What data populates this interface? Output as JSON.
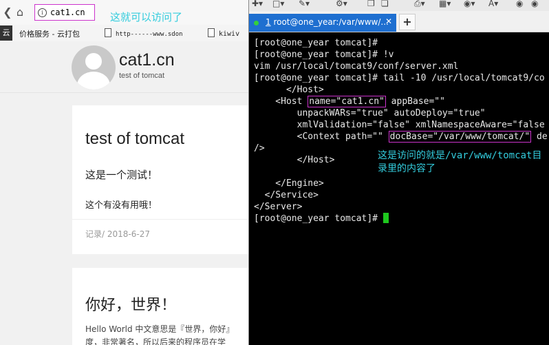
{
  "browser": {
    "url": "cat1.cn",
    "annotation": "这就可以访问了",
    "bookmarks": {
      "cloud": "云",
      "item1": "价格服务 - 云打包",
      "item2": "http------www.sdon",
      "item3": "kiwiv"
    },
    "site": {
      "title": "cat1.cn",
      "subtitle": "test of tomcat"
    },
    "post1": {
      "title": "test of tomcat",
      "line1": "这是一个测试！",
      "line2": "这个有没有用哦！",
      "meta": "记录/  2018-6-27"
    },
    "post2": {
      "title": "你好，世界！",
      "excerpt_line1": "Hello World 中文意思是『世界，你好』",
      "excerpt_line2": "度，非常著名，所以后来的程序员在学"
    }
  },
  "terminal": {
    "tab_number": "1",
    "tab_title": " root@one_year:/var/www/...",
    "lines": {
      "l1": "[root@one_year tomcat]#",
      "l2": "[root@one_year tomcat]# !v",
      "l3": "vim /usr/local/tomcat9/conf/server.xml",
      "l4": "[root@one_year tomcat]# tail -10 /usr/local/tomcat9/co",
      "l5": "      </Host>",
      "l6_pre": "    <Host ",
      "l6_box": "name=\"cat1.cn\"",
      "l6_post": " appBase=\"\"",
      "l7": "        unpackWARs=\"true\" autoDeploy=\"true\"",
      "l8": "        xmlValidation=\"false\" xmlNamespaceAware=\"false",
      "l9_pre": "        <Context path=\"\" ",
      "l9_box": "docBase=\"/var/www/tomcat/\"",
      "l9_post": " de",
      "l10": "/>",
      "l11": "        </Host>",
      "l12": "    </Engine>",
      "l13": "  </Service>",
      "l14": "</Server>",
      "l15": "[root@one_year tomcat]# "
    },
    "annotation": {
      "line1_a": "这是访问的就是",
      "line1_b": "/var/www/tomcat",
      "line1_c": "目",
      "line2": "录里的内容了"
    }
  },
  "colors": {
    "annotation": "#33ccdd",
    "highlight_box": "#cc33cc",
    "tab_active": "#1e6fd0",
    "cursor": "#1ec81e"
  }
}
